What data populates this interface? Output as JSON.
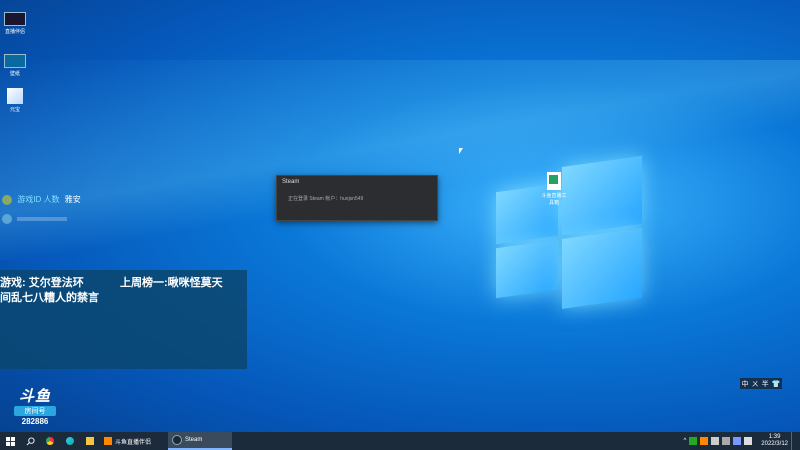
{
  "desktop": {
    "icons": [
      {
        "label": "直播伴侣"
      },
      {
        "label": "壁纸"
      },
      {
        "label": "元宝"
      }
    ],
    "file": {
      "label": "斗鱼直播工具箱"
    }
  },
  "steam_popup": {
    "title": "Steam",
    "message": "正在登录 Steam 帐户：huojsn549"
  },
  "chat": [
    {
      "user": "游戏ID 人数",
      "text": "雅安"
    },
    {
      "user": "",
      "text": ""
    }
  ],
  "overlay": {
    "line1_left": "游戏: 艾尔登法环",
    "line1_right": "上周榜一:啾咪怪莫天",
    "line2": "间乱七八糟人的禁言"
  },
  "douyu": {
    "logo": "斗鱼",
    "room_label": "房间号",
    "room_number": "282886"
  },
  "ime": {
    "chars": [
      "中",
      "ㄨ",
      "半",
      "👕"
    ]
  },
  "taskbar": {
    "apps": [
      {
        "label": "斗鱼直播伴侣",
        "icon": "douyu-icon",
        "active": false
      },
      {
        "label": "Steam",
        "icon": "steam-icon",
        "active": true
      }
    ],
    "clock": {
      "time": "1:39",
      "date": "2022/3/12"
    }
  }
}
